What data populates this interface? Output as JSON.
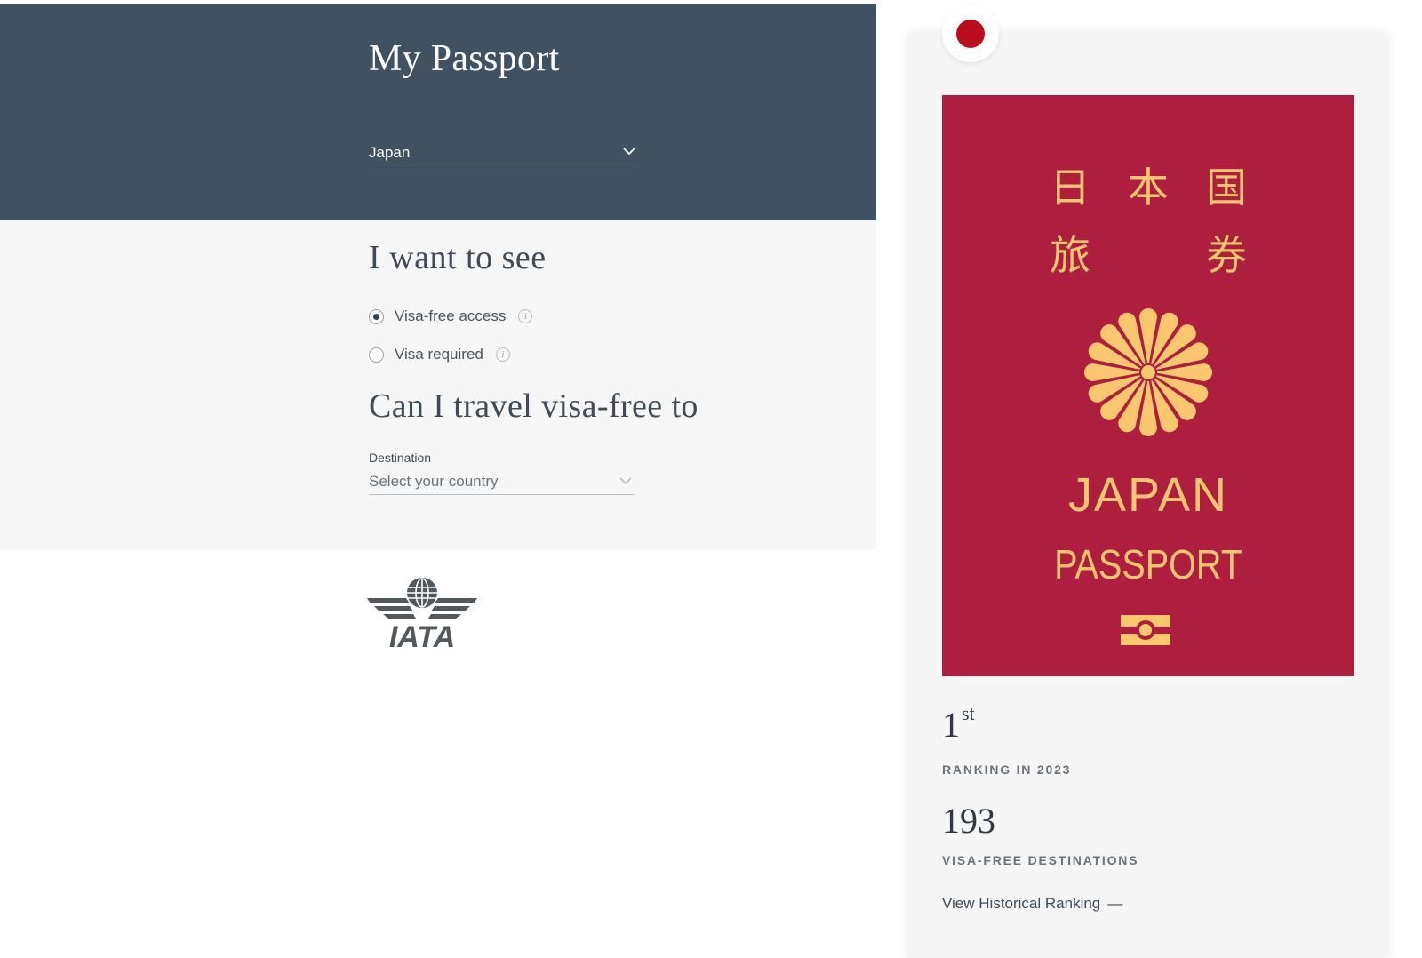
{
  "header": {
    "title": "My Passport",
    "passport_country": "Japan"
  },
  "form": {
    "see_heading": "I want to see",
    "options": [
      {
        "label": "Visa-free access",
        "selected": true
      },
      {
        "label": "Visa required",
        "selected": false
      }
    ],
    "travel_heading": "Can I travel visa-free to",
    "destination_label": "Destination",
    "destination_placeholder": "Select your country"
  },
  "logo": {
    "text": "IATA"
  },
  "card": {
    "flag_color": "#bc0d1f",
    "cover_color": "#ae1e3e",
    "emblem_color": "#f9c76e",
    "cover_script_top": [
      "日",
      "本",
      "国"
    ],
    "cover_script_bottom": [
      "旅",
      "券"
    ],
    "cover_country": "JAPAN",
    "cover_type": "PASSPORT",
    "rank_number": "1",
    "rank_suffix": "st",
    "rank_label": "RANKING IN 2023",
    "destinations_count": "193",
    "destinations_label": "VISA-FREE DESTINATIONS",
    "history_link": "View Historical Ranking",
    "history_dash": "—"
  },
  "icons": {
    "info": "info-icon",
    "chevron": "chevron-down-icon"
  }
}
